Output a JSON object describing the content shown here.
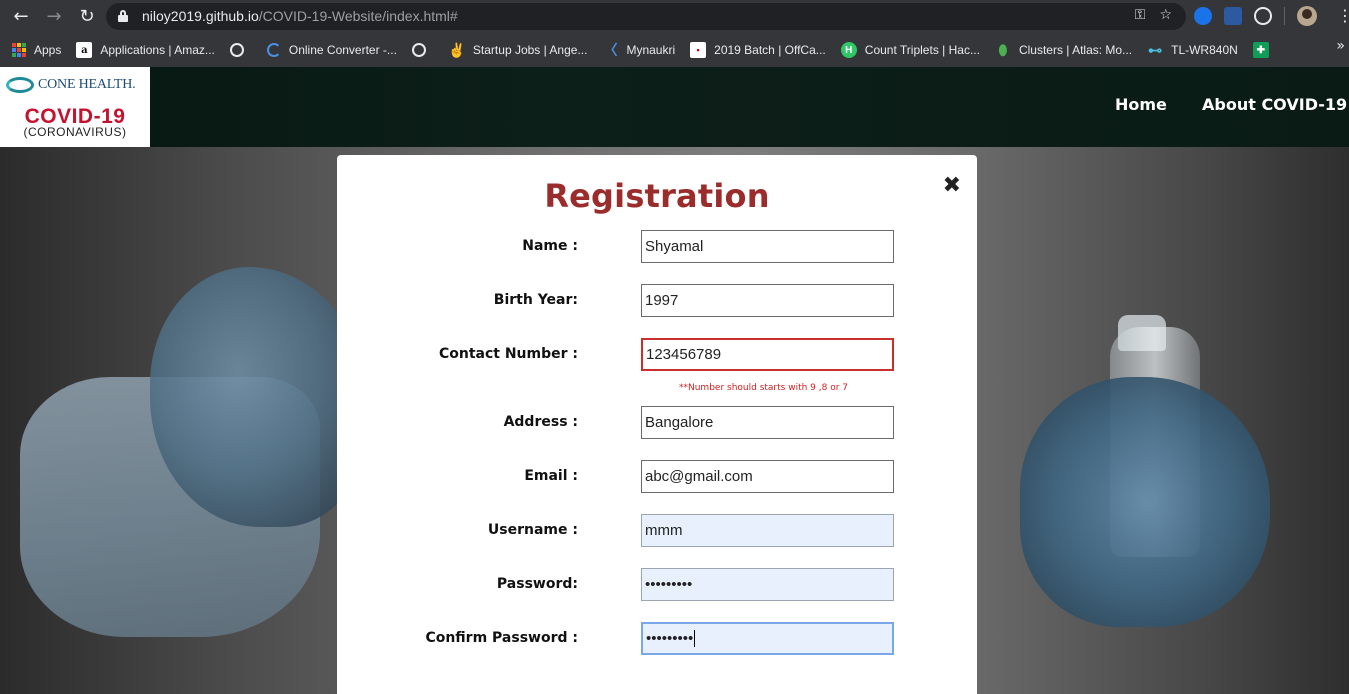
{
  "browser": {
    "url_host": "niloy2019.github.io",
    "url_path": "/COVID-19-Website/index.html#",
    "nav": {
      "back": "←",
      "forward": "→",
      "reload": "↻"
    },
    "omni_icons": {
      "key": "⚿",
      "star": "☆"
    },
    "menu": "⋮",
    "bookmarks": [
      {
        "label": "Apps",
        "icon": "apps-grid-icon"
      },
      {
        "label": "Applications | Amaz...",
        "icon": "amazon-icon",
        "glyph": "a"
      },
      {
        "label": "",
        "icon": "globe-icon"
      },
      {
        "label": "Online Converter -...",
        "icon": "converter-icon"
      },
      {
        "label": "",
        "icon": "globe-icon"
      },
      {
        "label": "Startup Jobs | Ange...",
        "icon": "angellist-icon",
        "glyph": "✌"
      },
      {
        "label": "Mynaukri",
        "icon": "mynaukri-icon",
        "glyph": "〈"
      },
      {
        "label": "2019 Batch | OffCa...",
        "icon": "offcampus-icon",
        "glyph": "▪"
      },
      {
        "label": "Count Triplets | Hac...",
        "icon": "hackerrank-icon",
        "glyph": "H"
      },
      {
        "label": "Clusters | Atlas: Mo...",
        "icon": "mongodb-leaf-icon",
        "glyph": "⬮"
      },
      {
        "label": "TL-WR840N",
        "icon": "tplink-icon",
        "glyph": "⊷"
      },
      {
        "label": "",
        "icon": "green-plus-icon",
        "glyph": "✚"
      }
    ],
    "bookmarks_more": "»"
  },
  "site": {
    "logo": {
      "brand": "CONE HEALTH.",
      "title": "COVID-19",
      "subtitle": "(CORONAVIRUS)"
    },
    "nav": [
      {
        "label": "Home"
      },
      {
        "label": "About COVID-19"
      }
    ]
  },
  "modal": {
    "title": "Registration",
    "close": "✖",
    "fields": [
      {
        "label": "Name :",
        "value": "Shyamal"
      },
      {
        "label": "Birth Year:",
        "value": "1997"
      },
      {
        "label": "Contact Number :",
        "value": "123456789"
      },
      {
        "label": "Address :",
        "value": "Bangalore"
      },
      {
        "label": "Email :",
        "value": "abc@gmail.com"
      },
      {
        "label": "Username :",
        "value": "mmm"
      },
      {
        "label": "Password:",
        "value": "•••••••••"
      },
      {
        "label": "Confirm Password :",
        "value": "•••••••••"
      }
    ],
    "contact_error": "**Number should starts with 9 ,8 or 7"
  },
  "colors": {
    "title": "#9b2c2c",
    "error": "#d02020",
    "covid_red": "#c4122f",
    "autofill_bg": "#e8f0fe"
  }
}
